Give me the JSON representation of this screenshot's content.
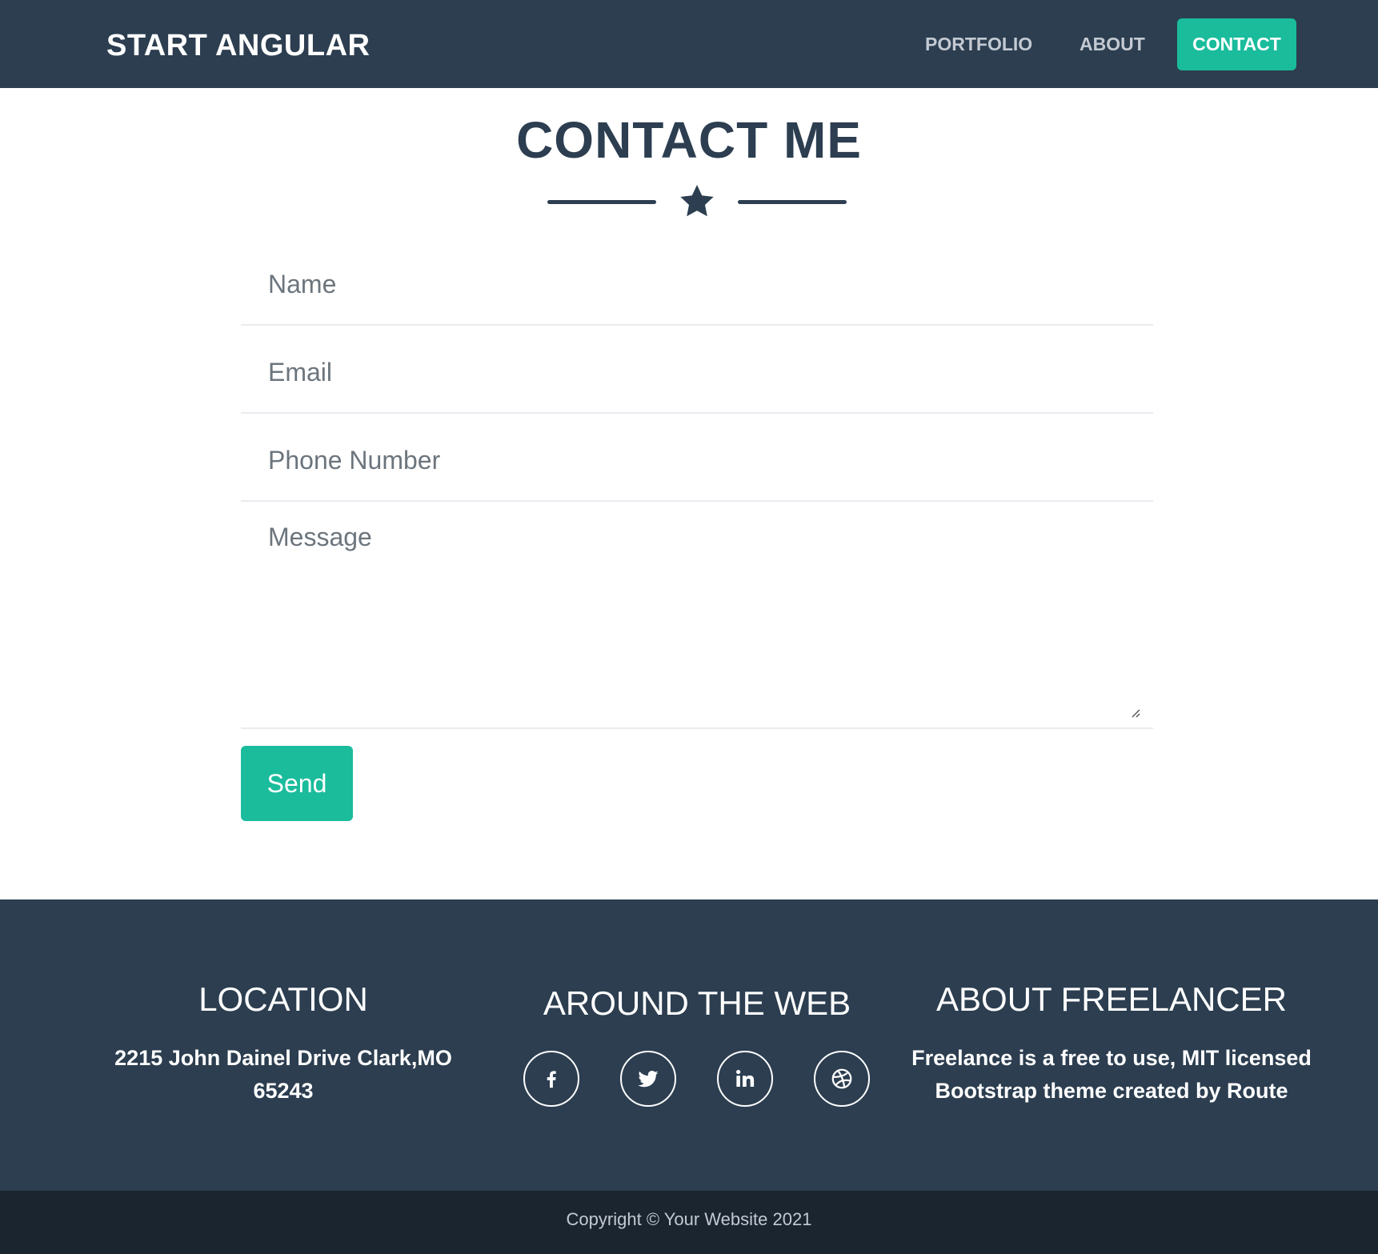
{
  "navbar": {
    "brand": "START ANGULAR",
    "links": [
      {
        "label": "PORTFOLIO"
      },
      {
        "label": "ABOUT"
      },
      {
        "label": "CONTACT",
        "active": true
      }
    ]
  },
  "contact": {
    "title": "CONTACT ME",
    "divider_icon": "star-icon",
    "fields": {
      "name_placeholder": "Name",
      "email_placeholder": "Email",
      "phone_placeholder": "Phone Number",
      "message_placeholder": "Message"
    },
    "send_label": "Send"
  },
  "footer": {
    "location": {
      "title": "LOCATION",
      "address_line1": "2215 John Dainel Drive Clark,MO",
      "address_line2": "65243"
    },
    "social": {
      "title": "AROUND THE WEB",
      "icons": [
        "facebook-icon",
        "twitter-icon",
        "linkedin-icon",
        "dribbble-icon"
      ]
    },
    "about": {
      "title": "ABOUT FREELANCER",
      "line1": "Freelance is a free to use, MIT licensed",
      "line2": "Bootstrap theme created by Route"
    },
    "copyright": "Copyright © Your Website 2021"
  },
  "colors": {
    "primary": "#2c3e50",
    "accent": "#1abc9c",
    "footer_dark": "#1a252f"
  }
}
